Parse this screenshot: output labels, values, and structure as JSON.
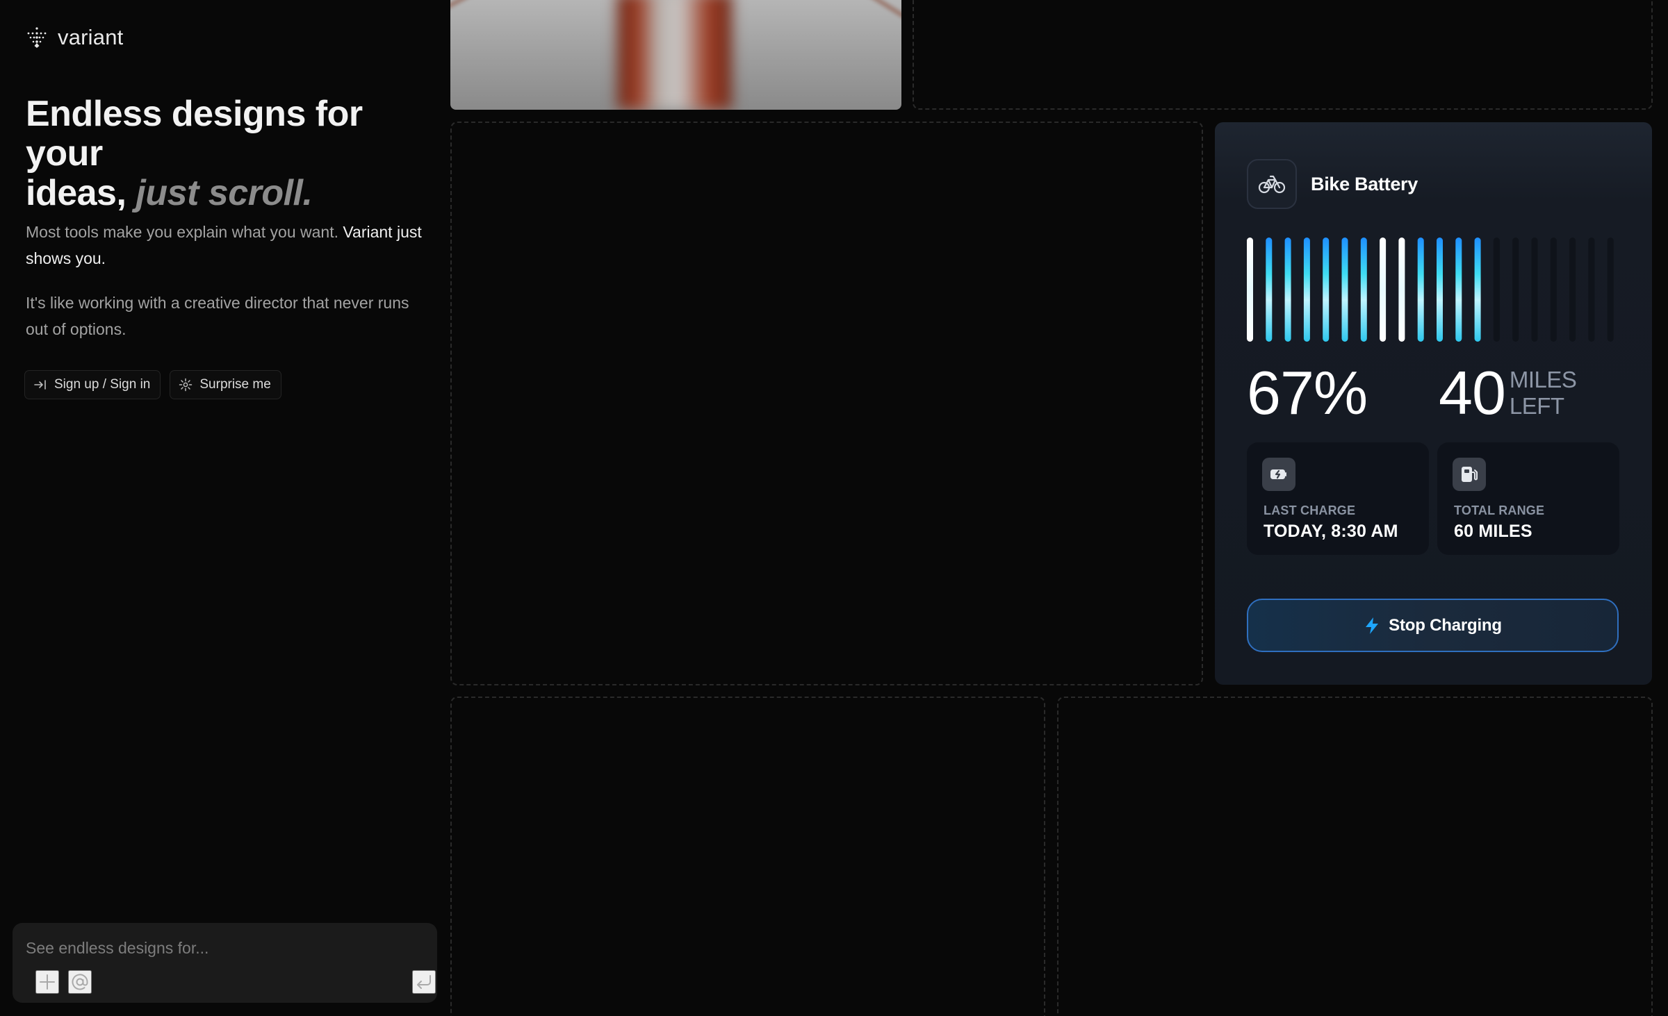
{
  "brand": {
    "name": "variant",
    "icon": "variant-logo-icon"
  },
  "hero": {
    "line1": "Endless designs for your",
    "line2": "ideas,",
    "emphasis": "just scroll."
  },
  "intro": {
    "p1_text": "Most tools make you explain what you want.",
    "p1_strong": "Variant just shows you.",
    "p2_text": "It's like working with a creative director that never runs out of options."
  },
  "actions": {
    "signup_label": "Sign up / Sign in",
    "signup_icon": "arrow-right-to-line-icon",
    "surprise_label": "Surprise me",
    "surprise_icon": "sparkle-icon"
  },
  "prompt": {
    "placeholder": "See endless designs for...",
    "value": "",
    "icons": [
      "plus-icon",
      "at-icon",
      "enter-icon"
    ]
  },
  "widget": {
    "title": "Bike Battery",
    "icon": "bicycle-icon",
    "percent_label": "67%",
    "charge_fraction": 0.67,
    "bars_total": 20,
    "bars_lit": 13,
    "miles_value": "40",
    "miles_unit_line1": "MILES",
    "miles_unit_line2": "LEFT",
    "stats": [
      {
        "label": "LAST CHARGE",
        "value": "TODAY, 8:30 AM",
        "icon": "battery-charging-icon"
      },
      {
        "label": "TOTAL RANGE",
        "value": "60 MILES",
        "icon": "fuel-station-icon"
      }
    ],
    "cta_label": "Stop Charging",
    "cta_icon": "lightning-icon",
    "colors": {
      "accent": "#1ea7ff",
      "cyan": "#38e0f0",
      "card_bg": "#161b24",
      "bar_off": "#0f131a"
    }
  }
}
